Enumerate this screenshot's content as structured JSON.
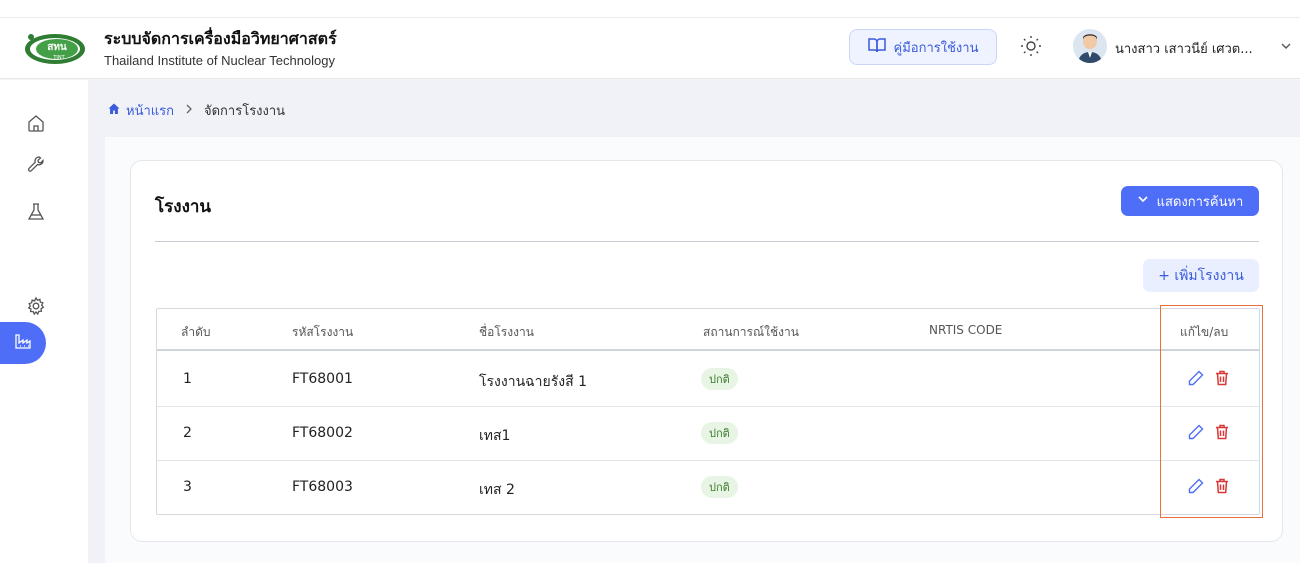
{
  "header": {
    "logo_text": "สทน",
    "logo_sub": "TINT",
    "title": "ระบบจัดการเครื่องมือวิทยาศาสตร์",
    "subtitle": "Thailand Institute of Nuclear Technology",
    "manual_label": "คู่มือการใช้งาน",
    "user_name": "นางสาว เสาวนีย์ เศวต...",
    "icons": [
      "book-icon",
      "sun-icon",
      "chevron-down-icon"
    ]
  },
  "sidebar": {
    "items": [
      {
        "name": "home-icon",
        "active": false
      },
      {
        "name": "wrench-icon",
        "active": false
      },
      {
        "name": "flask-icon",
        "active": false
      },
      {
        "name": "factory-icon",
        "active": true
      },
      {
        "name": "gear-icon",
        "active": false
      }
    ]
  },
  "breadcrumb": {
    "home": "หน้าแรก",
    "current": "จัดการโรงงาน"
  },
  "card": {
    "title": "โรงงาน",
    "search_toggle_label": "แสดงการค้นหา",
    "add_label": "+ เพิ่มโรงงาน"
  },
  "table": {
    "columns": [
      "ลำดับ",
      "รหัสโรงงาน",
      "ชื่อโรงงาน",
      "สถานการณ์ใช้งาน",
      "NRTIS CODE",
      "แก้ไข/ลบ"
    ],
    "rows": [
      {
        "no": "1",
        "code": "FT68001",
        "name": "โรงงานฉายรังสี 1",
        "status": "ปกติ",
        "nrtis": ""
      },
      {
        "no": "2",
        "code": "FT68002",
        "name": "เทส1",
        "status": "ปกติ",
        "nrtis": ""
      },
      {
        "no": "3",
        "code": "FT68003",
        "name": "เทส 2",
        "status": "ปกติ",
        "nrtis": ""
      }
    ]
  },
  "colors": {
    "primary": "#4f6ef7",
    "status_bg": "#e8f5e4",
    "status_text": "#3d7a2f",
    "delete": "#d93636",
    "highlight": "#e8703a"
  }
}
